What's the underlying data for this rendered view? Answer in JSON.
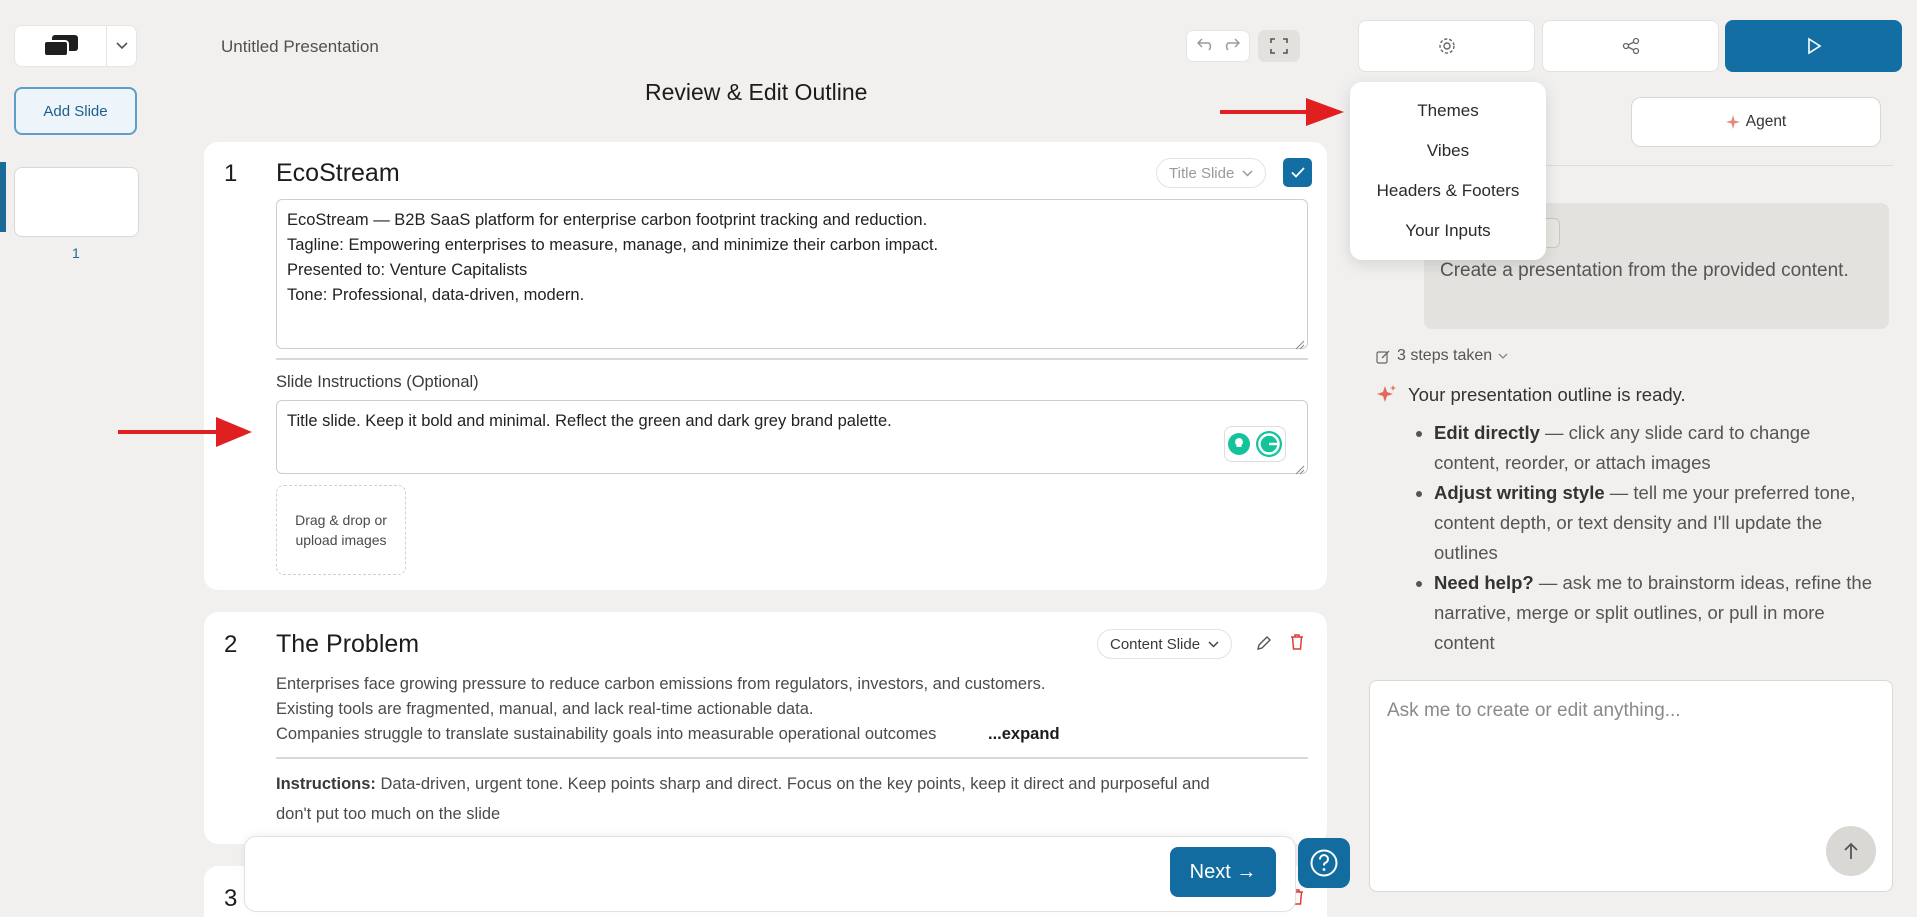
{
  "app": {
    "doc_title": "Untitled Presentation",
    "heading": "Review & Edit Outline"
  },
  "left_rail": {
    "add_slide_label": "Add Slide",
    "thumb_number": "1"
  },
  "slides": [
    {
      "number": "1",
      "title": "EcoStream",
      "type": "Title Slide",
      "content_lines": [
        "EcoStream — B2B SaaS platform for enterprise carbon footprint tracking and reduction.",
        "Tagline: Empowering enterprises to measure, manage, and minimize their carbon impact.",
        "Presented to: Venture Capitalists",
        "Tone: Professional, data-driven, modern."
      ],
      "instructions_label": "Slide Instructions (Optional)",
      "instructions": "Title slide. Keep it bold and minimal. Reflect the green and dark grey brand palette.",
      "upload_label_1": "Drag & drop or",
      "upload_label_2": "upload images"
    },
    {
      "number": "2",
      "title": "The Problem",
      "type": "Content Slide",
      "content_lines": [
        "Enterprises face growing pressure to reduce carbon emissions from regulators, investors, and customers.",
        "Existing tools are fragmented, manual, and lack real-time actionable data.",
        "Companies struggle to translate sustainability goals into measurable operational outcomes"
      ],
      "expand_label": "...expand",
      "instructions_prefix": "Instructions:",
      "instructions_line1": "Data-driven, urgent tone. Keep points sharp and direct. Focus on the key points, keep it direct and purposeful and",
      "instructions_line2": "don't put too much on the slide"
    },
    {
      "number": "3"
    }
  ],
  "bottom": {
    "next_label": "Next →"
  },
  "menu": {
    "items": [
      "Themes",
      "Vibes",
      "Headers & Footers",
      "Your Inputs"
    ]
  },
  "right_panel": {
    "agent_tab": "Agent",
    "user_message": "Create a presentation from the provided content.",
    "steps_label": "3 steps taken",
    "ready_text": "Your presentation outline is ready.",
    "bullets": [
      {
        "bold": "Edit directly",
        "text": " — click any slide card to change content, reorder, or attach images"
      },
      {
        "bold": "Adjust writing style",
        "text": " — tell me your preferred tone, content depth, or text density and I'll update the outlines"
      },
      {
        "bold": "Need help?",
        "text": " — ask me to brainstorm ideas, refine the narrative, merge or split outlines, or pull in more content"
      }
    ],
    "chat_placeholder": "Ask me to create or edit anything..."
  },
  "colors": {
    "accent": "#136fa3",
    "background": "#f1f0ee",
    "annotation_arrow": "#e02020",
    "delete_icon": "#e03a3a"
  }
}
